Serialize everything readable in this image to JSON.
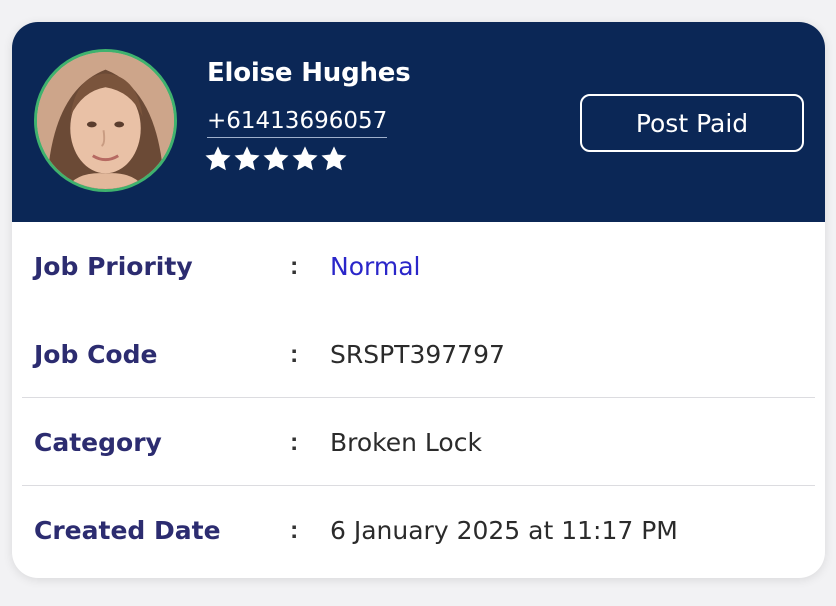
{
  "customer": {
    "name": "Eloise Hughes",
    "phone": "+61413696057",
    "rating": 5,
    "rating_max": 5,
    "plan_button": "Post Paid"
  },
  "details": [
    {
      "label": "Job Priority",
      "separator": ":",
      "value": "Normal"
    },
    {
      "label": "Job Code",
      "separator": ":",
      "value": "SRSPT397797"
    },
    {
      "label": "Category",
      "separator": ":",
      "value": "Broken Lock"
    },
    {
      "label": "Created Date",
      "separator": ":",
      "value": "6 January 2025 at 11:17 PM"
    }
  ],
  "colors": {
    "header_bg": "#0b2756",
    "label": "#2c2c70",
    "priority_value": "#2a26c9",
    "avatar_ring": "#3fb26e"
  },
  "icons": {
    "star": "star-icon",
    "avatar": "customer-photo"
  }
}
